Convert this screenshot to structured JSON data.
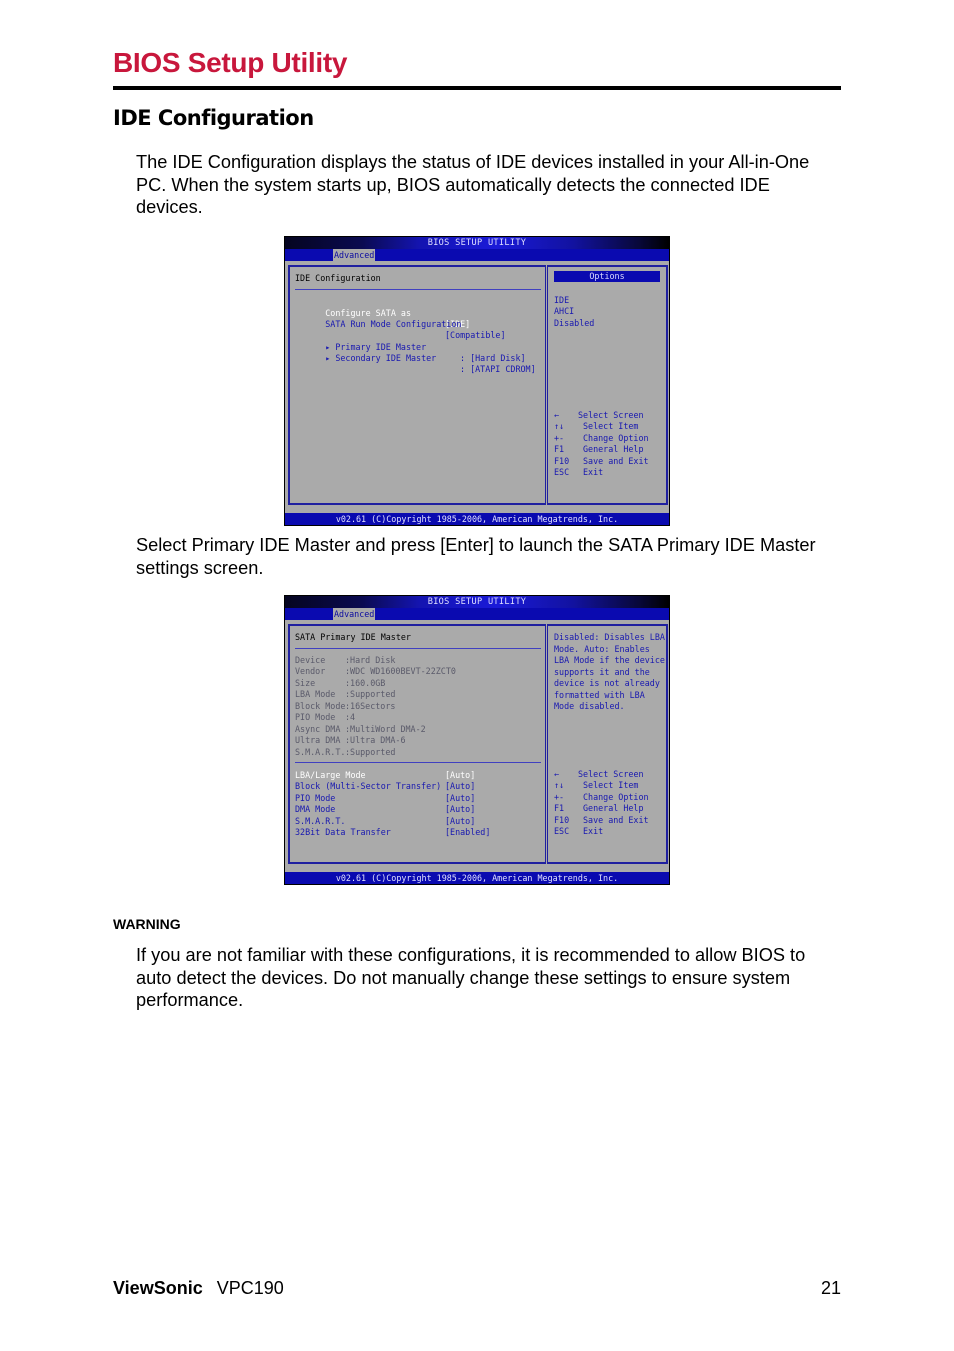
{
  "page": {
    "title": "BIOS Setup Utility",
    "section_title": "IDE Configuration",
    "intro": "The IDE Configuration displays the status of IDE devices installed in your All-in-One PC. When the system starts up, BIOS automatically detects the connected IDE devices.",
    "instruction": "Select Primary IDE Master and press [Enter] to launch the SATA Primary IDE Master settings screen.",
    "warning_label": "WARNING",
    "warning_text": "If you are not familiar with these configurations, it is recommended to allow BIOS to auto detect the devices. Do not manually change these settings to ensure system performance.",
    "accent_color": "#c8173c"
  },
  "footer": {
    "brand": "ViewSonic",
    "model": "VPC190",
    "page_number": "21"
  },
  "bios1": {
    "title": "BIOS SETUP UTILITY",
    "tab": "Advanced",
    "heading": "IDE Configuration",
    "settings": [
      {
        "label": "Configure SATA as",
        "value": "[IDE]"
      },
      {
        "label": "SATA Run Mode Configuration",
        "value": "[Compatible]"
      }
    ],
    "submenus": [
      {
        "label": "▸ Primary IDE Master",
        "value": ": [Hard Disk]"
      },
      {
        "label": "▸ Secondary IDE Master",
        "value": ": [ATAPI CDROM]"
      }
    ],
    "options_header": "Options",
    "options": [
      "IDE",
      "AHCI",
      "Disabled"
    ],
    "keys": [
      {
        "key": "←",
        "desc": "Select Screen"
      },
      {
        "key": "↑↓",
        "desc": "Select Item"
      },
      {
        "key": "+-",
        "desc": "Change Option"
      },
      {
        "key": "F1",
        "desc": "General Help"
      },
      {
        "key": "F10",
        "desc": "Save and Exit"
      },
      {
        "key": "ESC",
        "desc": "Exit"
      }
    ],
    "copyright": "v02.61 (C)Copyright 1985-2006, American Megatrends, Inc."
  },
  "bios2": {
    "title": "BIOS SETUP UTILITY",
    "tab": "Advanced",
    "heading": "SATA Primary IDE Master",
    "info": [
      {
        "label": "Device",
        "value": ":Hard Disk"
      },
      {
        "label": "Vendor",
        "value": ":WDC WD1600BEVT-22ZCT0"
      },
      {
        "label": "Size",
        "value": ":160.0GB"
      },
      {
        "label": "LBA Mode",
        "value": ":Supported"
      },
      {
        "label": "Block Mode",
        "value": ":16Sectors"
      },
      {
        "label": "PIO Mode",
        "value": ":4"
      },
      {
        "label": "Async DMA",
        "value": ":MultiWord DMA-2"
      },
      {
        "label": "Ultra DMA",
        "value": ":Ultra DMA-6"
      },
      {
        "label": "S.M.A.R.T.",
        "value": ":Supported"
      }
    ],
    "settings": [
      {
        "label": "LBA/Large Mode",
        "value": "[Auto]"
      },
      {
        "label": "Block (Multi-Sector Transfer)",
        "value": "[Auto]"
      },
      {
        "label": "PIO Mode",
        "value": "[Auto]"
      },
      {
        "label": "DMA Mode",
        "value": "[Auto]"
      },
      {
        "label": "S.M.A.R.T.",
        "value": "[Auto]"
      },
      {
        "label": "32Bit Data Transfer",
        "value": "[Enabled]"
      }
    ],
    "help": "Disabled: Disables LBA Mode. Auto: Enables LBA Mode if the device supports it and the device is not already formatted with LBA Mode disabled.",
    "keys": [
      {
        "key": "←",
        "desc": "Select Screen"
      },
      {
        "key": "↑↓",
        "desc": "Select Item"
      },
      {
        "key": "+-",
        "desc": "Change Option"
      },
      {
        "key": "F1",
        "desc": "General Help"
      },
      {
        "key": "F10",
        "desc": "Save and Exit"
      },
      {
        "key": "ESC",
        "desc": "Exit"
      }
    ],
    "copyright": "v02.61 (C)Copyright 1985-2006, American Megatrends, Inc."
  }
}
